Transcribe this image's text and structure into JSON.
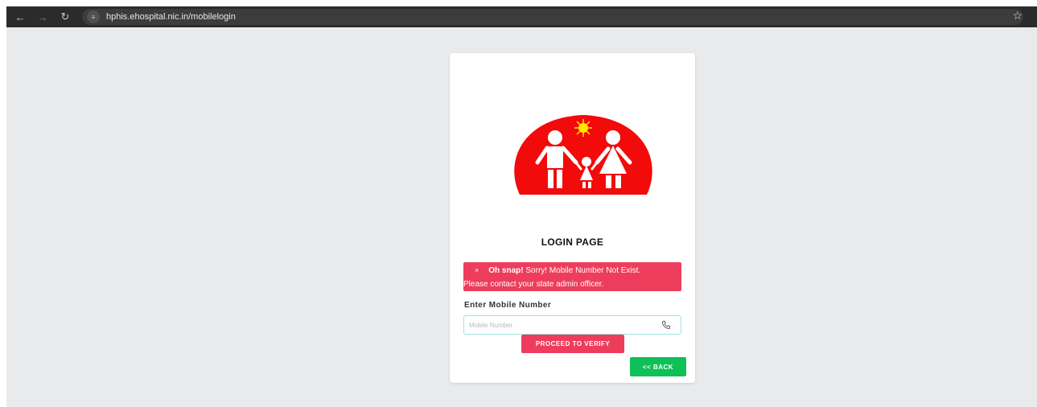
{
  "browser": {
    "back_icon": "arrow-left-icon",
    "forward_icon": "arrow-right-icon",
    "reload_icon": "reload-icon",
    "url": "hphis.ehospital.nic.in/mobilelogin",
    "bookmark_icon": "star-icon"
  },
  "login": {
    "title": "LOGIN PAGE",
    "alert": {
      "close": "×",
      "strong": "Oh snap!",
      "message": " Sorry! Mobile Number Not Exist.",
      "detail": "Please contact your state admin officer.",
      "color": "#ee3d5c"
    },
    "field_label": "Enter Mobile Number",
    "input": {
      "value": "",
      "placeholder": "Mobile Number"
    },
    "verify_button": "PROCEED TO VERIFY",
    "back_button": "<< BACK"
  },
  "colors": {
    "page_bg": "#e9eaec",
    "logo_red": "#f30a0a",
    "sun": "#ffe600",
    "verify": "#ee3d5c",
    "back": "#0fbf57"
  }
}
